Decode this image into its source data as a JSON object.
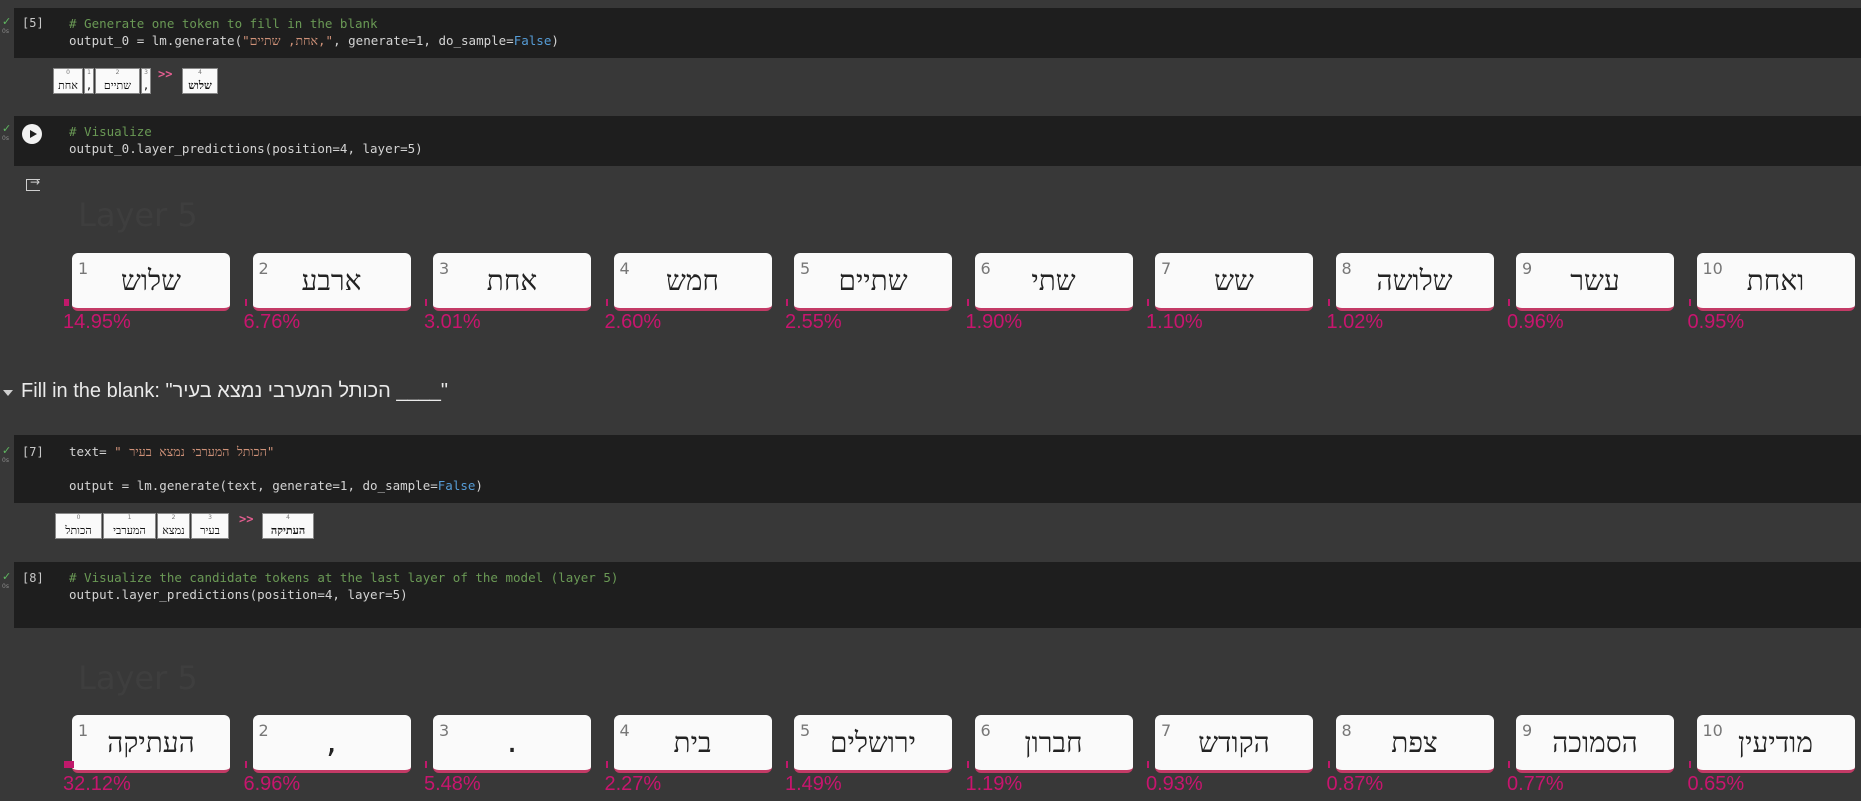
{
  "cell5": {
    "exec": "[5]",
    "line1": "# Generate one token to fill in the blank",
    "line2_a": "output_0 = lm.generate(",
    "line2_str": "\"אחת, שתיים,\"",
    "line2_b": ", generate=1, do_sample=",
    "line2_kw": "False",
    "line2_c": ")"
  },
  "tokens0": [
    {
      "idx": "0",
      "text": "אחת"
    },
    {
      "idx": "1",
      "text": ","
    },
    {
      "idx": "2",
      "text": "שתיים"
    },
    {
      "idx": "3",
      "text": ","
    }
  ],
  "tokens0_out": {
    "idx": "4",
    "text": "שלוש"
  },
  "arrow": ">>",
  "cell6": {
    "line1": "# Visualize",
    "line2": "output_0.layer_predictions(position=4, layer=5)"
  },
  "pred1": {
    "title": "Layer 5",
    "cards": [
      {
        "rank": "1",
        "token": "שלוש",
        "pct": "14.95%",
        "prob": 14.95
      },
      {
        "rank": "2",
        "token": "ארבע",
        "pct": "6.76%",
        "prob": 6.76
      },
      {
        "rank": "3",
        "token": "אחת",
        "pct": "3.01%",
        "prob": 3.01
      },
      {
        "rank": "4",
        "token": "חמש",
        "pct": "2.60%",
        "prob": 2.6
      },
      {
        "rank": "5",
        "token": "שתיים",
        "pct": "2.55%",
        "prob": 2.55
      },
      {
        "rank": "6",
        "token": "שתי",
        "pct": "1.90%",
        "prob": 1.9
      },
      {
        "rank": "7",
        "token": "שש",
        "pct": "1.10%",
        "prob": 1.1
      },
      {
        "rank": "8",
        "token": "שלושה",
        "pct": "1.02%",
        "prob": 1.02
      },
      {
        "rank": "9",
        "token": "עשר",
        "pct": "0.96%",
        "prob": 0.96
      },
      {
        "rank": "10",
        "token": "ואחת",
        "pct": "0.95%",
        "prob": 0.95
      }
    ]
  },
  "section": {
    "title": "Fill in the blank: \"הכותל המערבי נמצא בעיר ____\""
  },
  "cell7": {
    "exec": "[7]",
    "line1_a": "text= ",
    "line1_str": "\" הכותל המערבי נמצא בעיר\"",
    "line2_a": "output = lm.generate(text, generate=1, do_sample=",
    "line2_kw": "False",
    "line2_c": ")"
  },
  "tokens1": [
    {
      "idx": "0",
      "text": "הכותל"
    },
    {
      "idx": "1",
      "text": "המערבי"
    },
    {
      "idx": "2",
      "text": "נמצא"
    },
    {
      "idx": "3",
      "text": "בעיר"
    }
  ],
  "tokens1_out": {
    "idx": "4",
    "text": "העתיקה"
  },
  "cell8": {
    "exec": "[8]",
    "line1": "# Visualize the candidate tokens at the last layer of the model (layer 5)",
    "line2": "output.layer_predictions(position=4, layer=5)"
  },
  "pred2": {
    "title": "Layer 5",
    "cards": [
      {
        "rank": "1",
        "token": "העתיקה",
        "pct": "32.12%",
        "prob": 32.12
      },
      {
        "rank": "2",
        "token": ",",
        "pct": "6.96%",
        "prob": 6.96
      },
      {
        "rank": "3",
        "token": ".",
        "pct": "5.48%",
        "prob": 5.48
      },
      {
        "rank": "4",
        "token": "בית",
        "pct": "2.27%",
        "prob": 2.27
      },
      {
        "rank": "5",
        "token": "ירושלים",
        "pct": "1.49%",
        "prob": 1.49
      },
      {
        "rank": "6",
        "token": "חברון",
        "pct": "1.19%",
        "prob": 1.19
      },
      {
        "rank": "7",
        "token": "הקודש",
        "pct": "0.93%",
        "prob": 0.93
      },
      {
        "rank": "8",
        "token": "צפת",
        "pct": "0.87%",
        "prob": 0.87
      },
      {
        "rank": "9",
        "token": "הסמוכה",
        "pct": "0.77%",
        "prob": 0.77
      },
      {
        "rank": "10",
        "token": "מודיעין",
        "pct": "0.65%",
        "prob": 0.65
      }
    ]
  },
  "colors": {
    "accent": "#c8156e",
    "comment": "#6a9955",
    "keyword": "#569cd6",
    "string": "#ce9178",
    "run_ok": "#5fb760"
  }
}
